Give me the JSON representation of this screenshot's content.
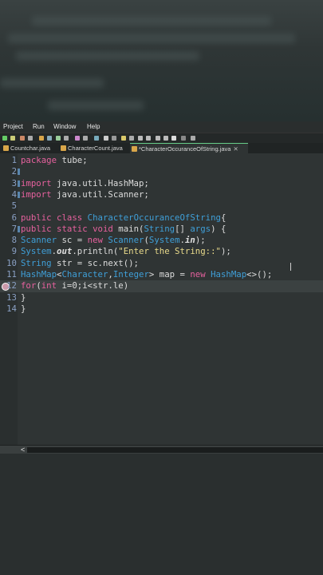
{
  "menu": {
    "items": [
      "Project",
      "Run",
      "Window",
      "Help"
    ]
  },
  "tabs": [
    {
      "label": "Countchar.java",
      "close": ""
    },
    {
      "label": "CharacterCount.java",
      "close": ""
    },
    {
      "label": "*CharacterOccuranceOfString.java",
      "close": "✕"
    }
  ],
  "editor": {
    "lines": [
      {
        "n": "1",
        "tokens": [
          [
            "kw",
            "package"
          ],
          [
            "p",
            " tube;"
          ]
        ]
      },
      {
        "n": "2",
        "tokens": []
      },
      {
        "n": "3",
        "tokens": [
          [
            "kw",
            "import"
          ],
          [
            "p",
            " java.util.HashMap;"
          ]
        ]
      },
      {
        "n": "4",
        "tokens": [
          [
            "kw",
            "import"
          ],
          [
            "p",
            " java.util.Scanner;"
          ]
        ]
      },
      {
        "n": "5",
        "tokens": []
      },
      {
        "n": "6",
        "tokens": [
          [
            "kw",
            "public"
          ],
          [
            "p",
            " "
          ],
          [
            "kw",
            "class"
          ],
          [
            "p",
            " "
          ],
          [
            "ty",
            "CharacterOccuranceOfString"
          ],
          [
            "p",
            "{"
          ]
        ]
      },
      {
        "n": "7",
        "tokens": [
          [
            "kw",
            "public"
          ],
          [
            "p",
            " "
          ],
          [
            "kw",
            "static"
          ],
          [
            "p",
            " "
          ],
          [
            "kw",
            "void"
          ],
          [
            "p",
            " main("
          ],
          [
            "ty",
            "String"
          ],
          [
            "p",
            "[] "
          ],
          [
            "ty",
            "args"
          ],
          [
            "p",
            ") {"
          ]
        ]
      },
      {
        "n": "8",
        "tokens": [
          [
            "ty",
            "Scanner"
          ],
          [
            "p",
            " sc = "
          ],
          [
            "kw",
            "new"
          ],
          [
            "p",
            " "
          ],
          [
            "ty",
            "Scanner"
          ],
          [
            "p",
            "("
          ],
          [
            "ty",
            "System"
          ],
          [
            "p",
            "."
          ],
          [
            "sf",
            "in"
          ],
          [
            "p",
            ");"
          ]
        ]
      },
      {
        "n": "9",
        "tokens": [
          [
            "ty",
            "System"
          ],
          [
            "p",
            "."
          ],
          [
            "sf",
            "out"
          ],
          [
            "p",
            ".println("
          ],
          [
            "st",
            "\"Enter the String::\""
          ],
          [
            "p",
            ");"
          ]
        ]
      },
      {
        "n": "10",
        "tokens": [
          [
            "ty",
            "String"
          ],
          [
            "p",
            " str = sc.next();"
          ]
        ]
      },
      {
        "n": "11",
        "tokens": [
          [
            "ty",
            "HashMap"
          ],
          [
            "p",
            "<"
          ],
          [
            "ty",
            "Character"
          ],
          [
            "p",
            ","
          ],
          [
            "ty",
            "Integer"
          ],
          [
            "p",
            "> map = "
          ],
          [
            "kw",
            "new"
          ],
          [
            "p",
            " "
          ],
          [
            "ty",
            "HashMap"
          ],
          [
            "p",
            "<>();"
          ]
        ]
      },
      {
        "n": "12",
        "tokens": [
          [
            "kw",
            "for"
          ],
          [
            "p",
            "("
          ],
          [
            "kw",
            "int"
          ],
          [
            "p",
            " i=0;i<str.le)"
          ]
        ]
      },
      {
        "n": "13",
        "tokens": [
          [
            "p",
            "}"
          ]
        ]
      },
      {
        "n": "14",
        "tokens": [
          [
            "p",
            "}"
          ]
        ]
      }
    ],
    "current_line": "12"
  },
  "scrollbar": {
    "left_arrow": "<"
  }
}
